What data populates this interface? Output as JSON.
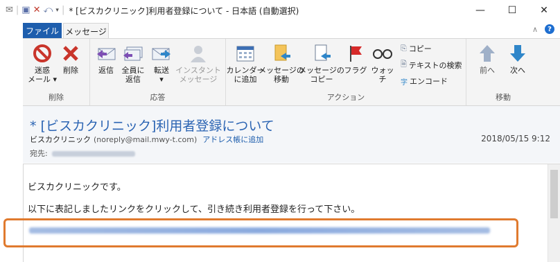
{
  "window": {
    "title": "* [ビスカクリニック]利用者登録について - 日本語 (自動選択)",
    "controls": {
      "minimize": "—",
      "maximize": "☐",
      "close": "✕"
    }
  },
  "quick_access": [
    "envelope-icon",
    "save-icon",
    "delete-icon",
    "reply-icon",
    "dropdown-icon"
  ],
  "tabs": {
    "file": "ファイル",
    "message": "メッセージ"
  },
  "ribbon": {
    "groups": {
      "delete": "削除",
      "respond": "応答",
      "actions": "アクション",
      "move": "移動"
    },
    "buttons": {
      "junk": "迷惑\nメール ▾",
      "delete": "削除",
      "reply": "返信",
      "reply_all": "全員に\n返信",
      "forward": "転送\n▾",
      "im": "インスタント\nメッセージ",
      "add_calendar": "カレンダー\nに追加",
      "move_msg": "メッセージの\n移動",
      "copy_msg": "メッセージの\nコピー",
      "flag": "フラグ",
      "watch": "ウォッチ",
      "copy": "コピー",
      "find_text": "テキストの検索",
      "encoding": "エンコード",
      "prev": "前へ",
      "next": "次へ"
    }
  },
  "message": {
    "subject": "* [ビスカクリニック]利用者登録について",
    "from_name": "ビスカクリニック",
    "from_addr": "(noreply@mail.mwy-t.com)",
    "add_to_contacts": "アドレス帳に追加",
    "date": "2018/05/15 9:12",
    "to_label": "宛先:",
    "body_line1": "ビスカクリニックです。",
    "body_line2": "以下に表記しましたリンクをクリックして、引き続き利用者登録を行って下さい。"
  },
  "colors": {
    "accent": "#1e5ead",
    "subject": "#2b64b3",
    "highlight": "#e07a2e"
  }
}
